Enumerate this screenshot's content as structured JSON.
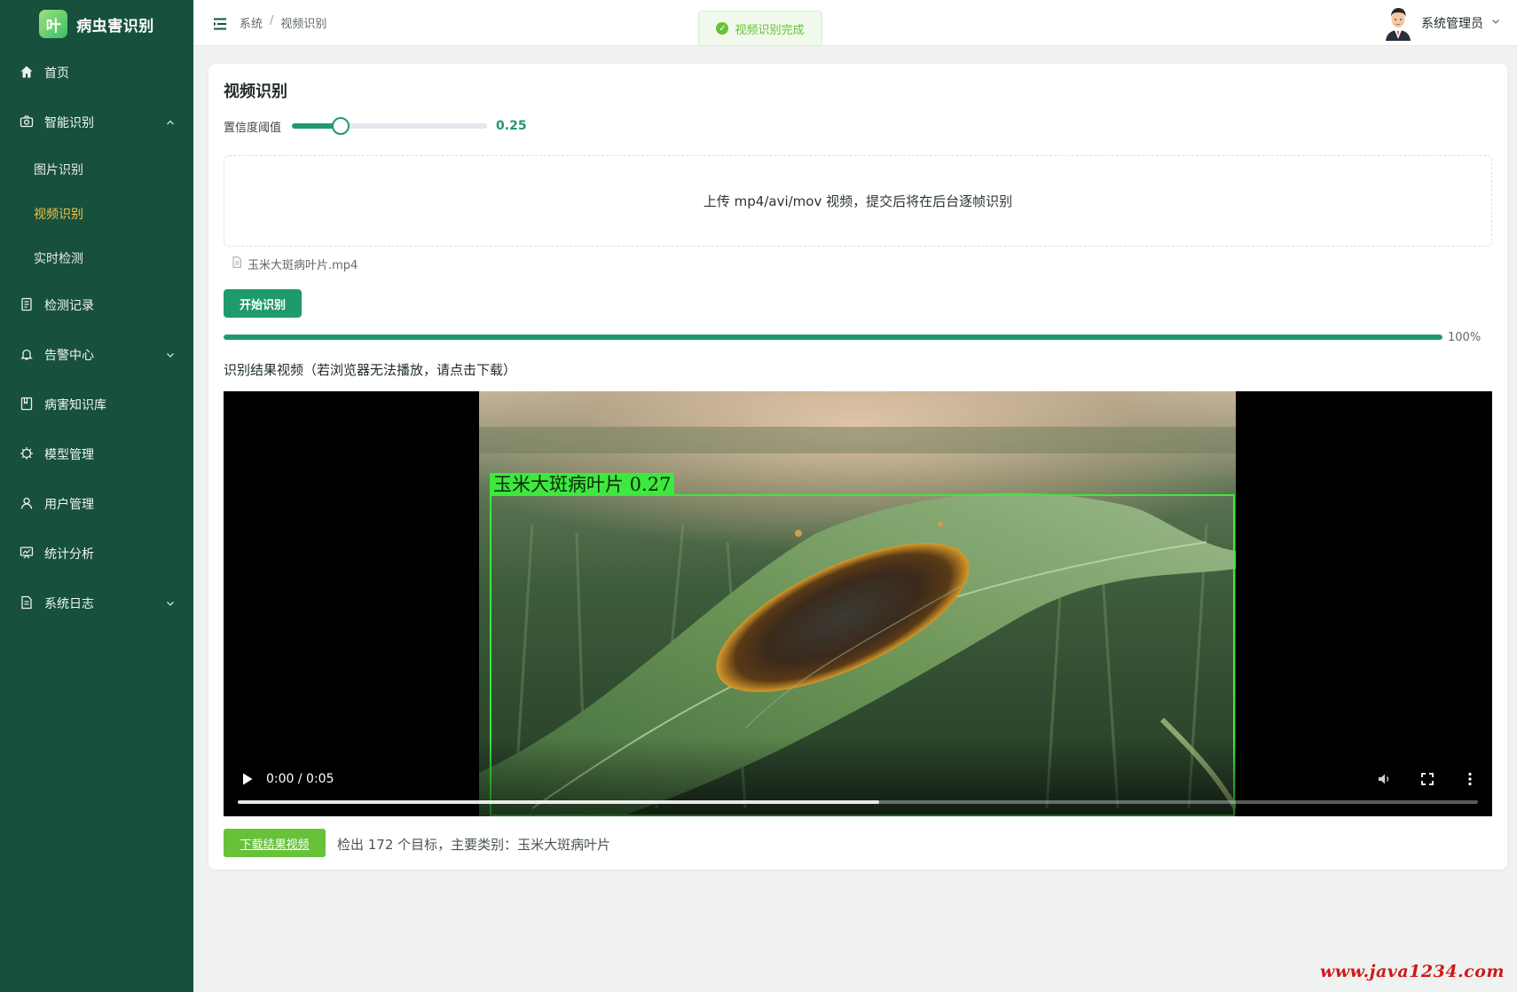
{
  "app": {
    "logo_char": "叶",
    "name": "病虫害识别"
  },
  "sidebar": {
    "items": [
      {
        "label": "首页",
        "icon": "home-icon"
      },
      {
        "label": "智能识别",
        "icon": "camera-icon",
        "expanded": true,
        "children": [
          {
            "label": "图片识别"
          },
          {
            "label": "视频识别",
            "active": true
          },
          {
            "label": "实时检测"
          }
        ]
      },
      {
        "label": "检测记录",
        "icon": "document-icon"
      },
      {
        "label": "告警中心",
        "icon": "bell-icon",
        "expandable": true
      },
      {
        "label": "病害知识库",
        "icon": "book-icon"
      },
      {
        "label": "模型管理",
        "icon": "chip-icon"
      },
      {
        "label": "用户管理",
        "icon": "user-icon"
      },
      {
        "label": "统计分析",
        "icon": "chart-icon"
      },
      {
        "label": "系统日志",
        "icon": "log-icon",
        "expandable": true
      }
    ]
  },
  "header": {
    "breadcrumb": [
      "系统",
      "视频识别"
    ],
    "toast": "视频识别完成",
    "user_name": "系统管理员"
  },
  "page": {
    "title": "视频识别",
    "threshold_label": "置信度阈值",
    "threshold_value": 0.25,
    "threshold_display": "0.25",
    "upload_hint": "上传 mp4/avi/mov 视频，提交后将在后台逐帧识别",
    "file_name": "玉米大斑病叶片.mp4",
    "start_button": "开始识别",
    "progress": 100,
    "progress_text": "100%",
    "result_caption": "识别结果视频（若浏览器无法播放，请点击下载）",
    "detection_label": "玉米大斑病叶片 0.27",
    "video_time": "0:00 / 0:05",
    "video_played_fraction": 0.517,
    "download_button": "下载结果视频",
    "summary": "检出 172 个目标，主要类别：玉米大斑病叶片"
  },
  "watermark": "www.java1234.com",
  "colors": {
    "sidebar": "#17503d",
    "primary": "#1e9a6d",
    "success": "#67c23a",
    "active_menu": "#f4c14a",
    "detection": "#3ee83e"
  }
}
